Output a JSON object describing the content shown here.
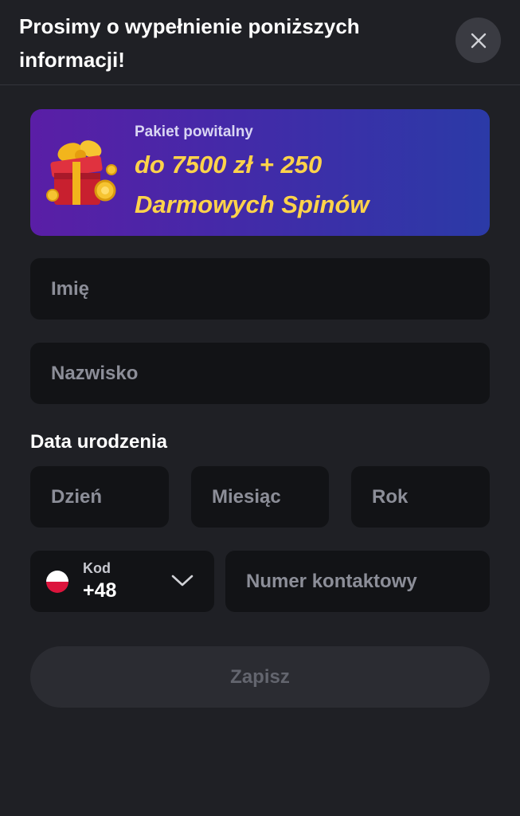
{
  "header": {
    "title": "Prosimy o wypełnienie poniższych informacji!",
    "close_icon": "close-icon"
  },
  "banner": {
    "subtitle": "Pakiet powitalny",
    "line1": "do 7500 zł + 250",
    "line2": "Darmowych Spinów",
    "icon": "gift-box-with-coins-icon",
    "accent_color": "#ffd34a"
  },
  "form": {
    "first_name_placeholder": "Imię",
    "last_name_placeholder": "Nazwisko",
    "dob_label": "Data urodzenia",
    "day_placeholder": "Dzień",
    "month_placeholder": "Miesiąc",
    "year_placeholder": "Rok",
    "country_code": {
      "label": "Kod",
      "value": "+48",
      "flag_icon": "poland-flag-icon"
    },
    "phone_placeholder": "Numer kontaktowy",
    "submit_label": "Zapisz"
  }
}
